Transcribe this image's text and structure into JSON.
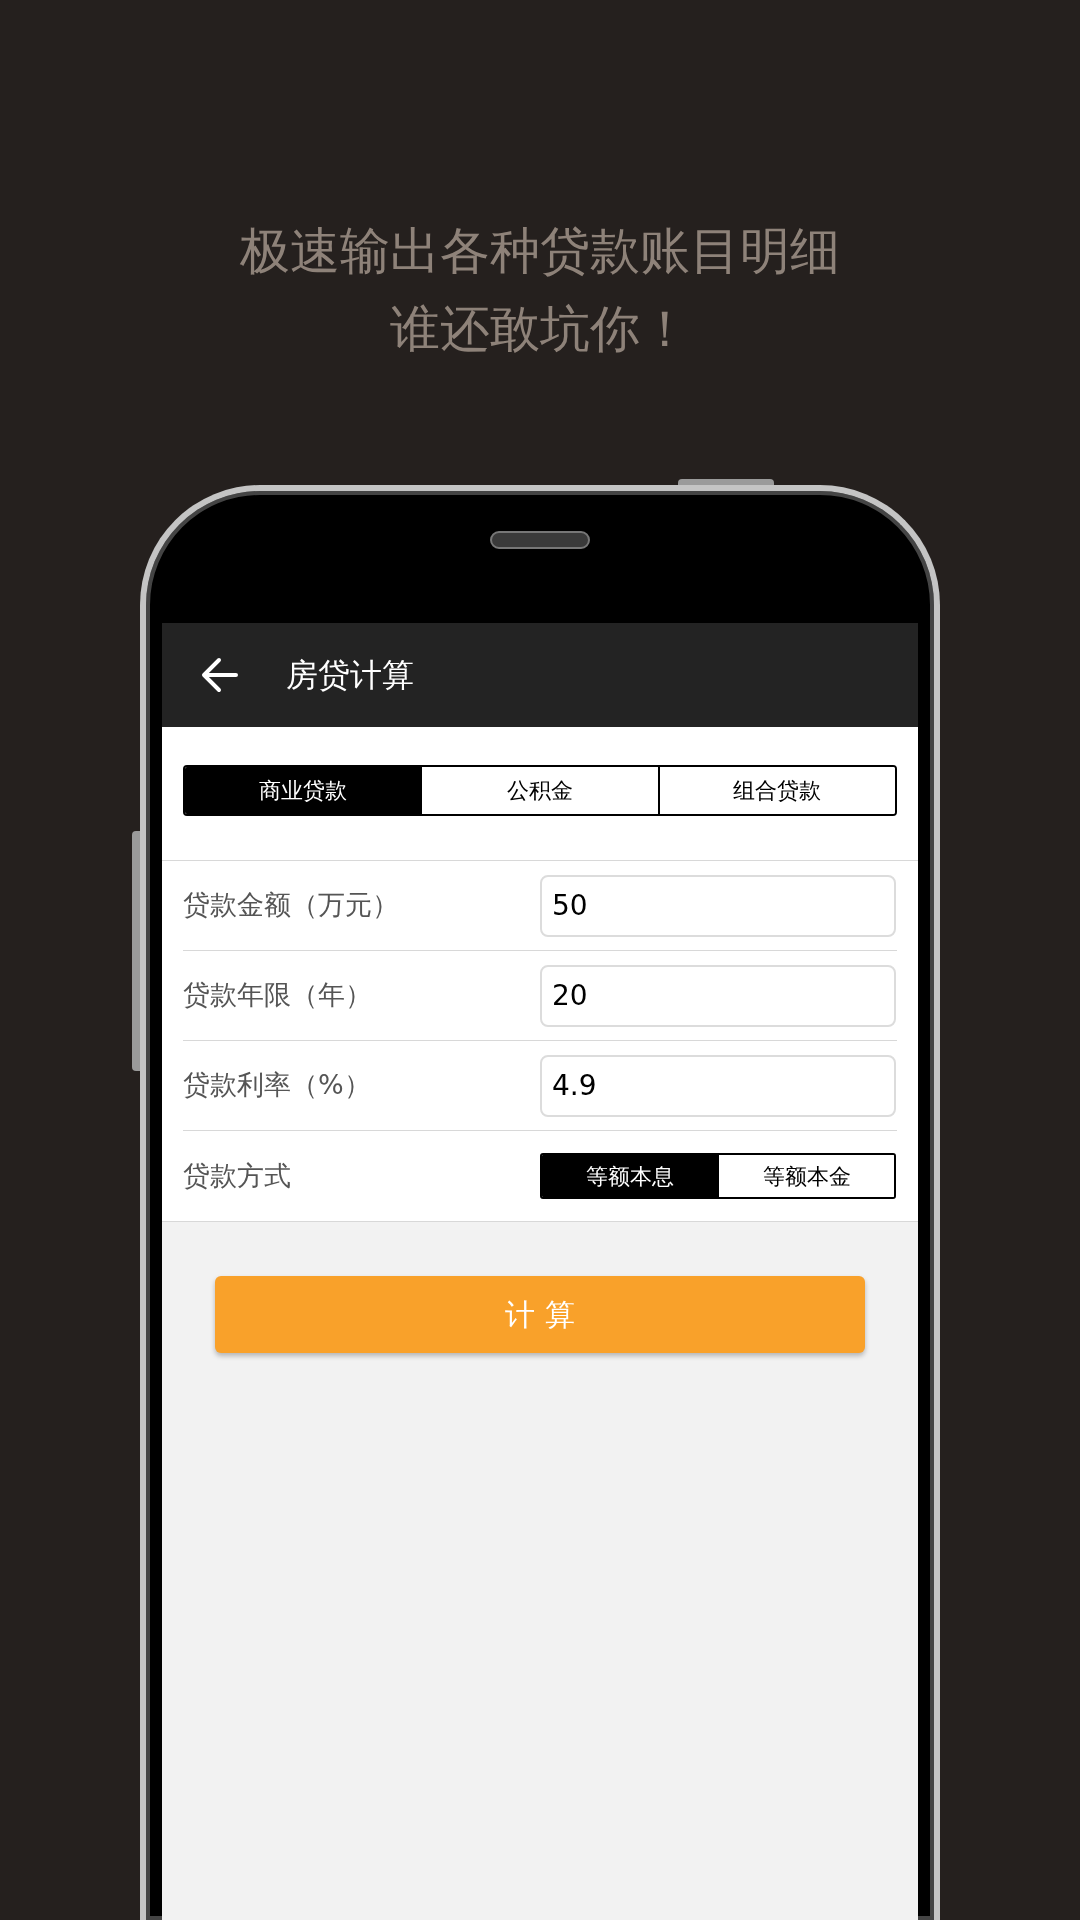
{
  "headline": [
    "极速输出各种贷款账目明细",
    "谁还敢坑你！"
  ],
  "app_bar": {
    "title": "房贷计算"
  },
  "tabs": [
    {
      "label": "商业贷款",
      "selected": true
    },
    {
      "label": "公积金",
      "selected": false
    },
    {
      "label": "组合贷款",
      "selected": false
    }
  ],
  "fields": [
    {
      "label": "贷款金额（万元）",
      "value": "50"
    },
    {
      "label": "贷款年限（年）",
      "value": "20"
    },
    {
      "label": "贷款利率（%）",
      "value": "4.9"
    }
  ],
  "repayment": {
    "label": "贷款方式",
    "options": [
      {
        "label": "等额本息",
        "selected": true
      },
      {
        "label": "等额本金",
        "selected": false
      }
    ]
  },
  "calculate_button": "计 算"
}
